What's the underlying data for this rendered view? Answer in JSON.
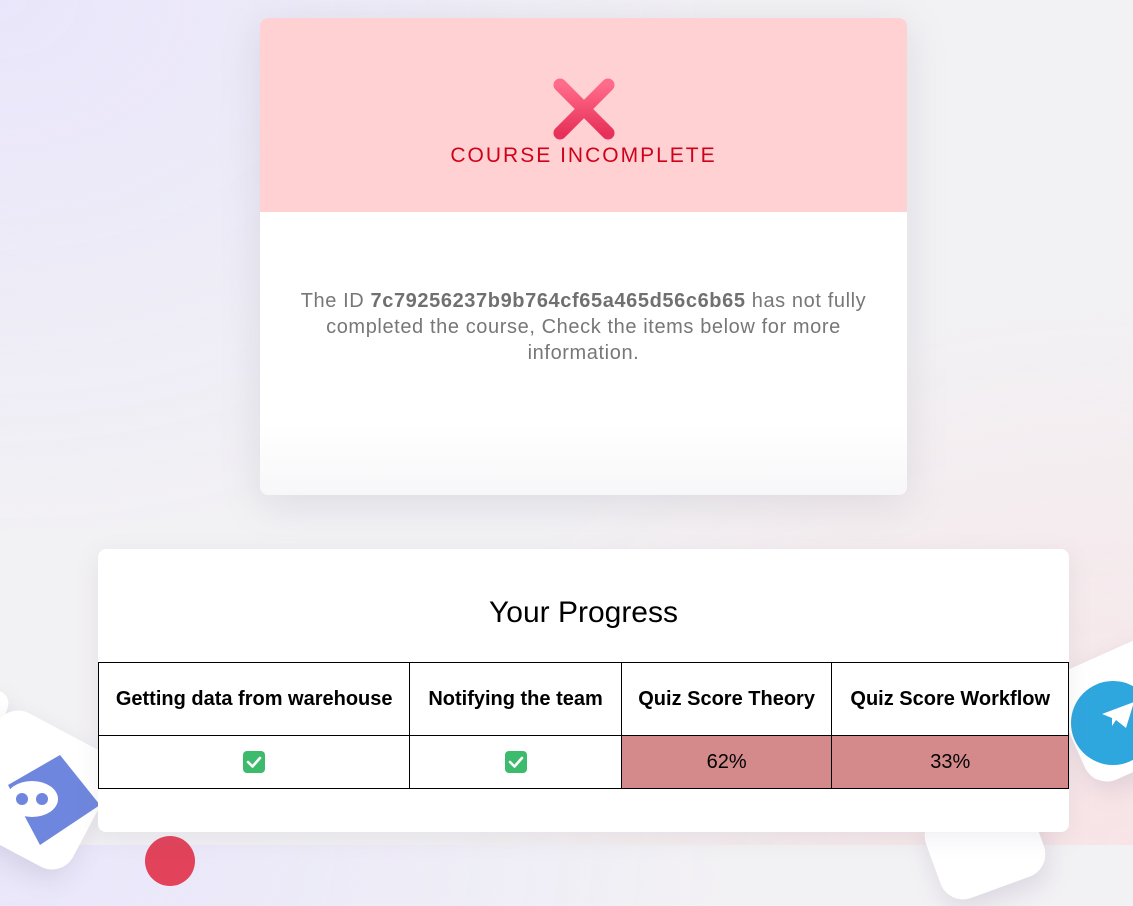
{
  "status": {
    "title": "COURSE INCOMPLETE",
    "icon": "x-icon",
    "message_prefix": "The ID ",
    "user_id": "7c79256237b9b764cf65a465d56c6b65",
    "message_suffix": " has not fully completed the course, Check the items below for more information.",
    "accent_color": "#d0021b",
    "header_color": "#ffd1d2"
  },
  "progress": {
    "title": "Your Progress",
    "columns": [
      "Getting data from warehouse",
      "Notifying the team",
      "Quiz Score Theory",
      "Quiz Score Workflow"
    ],
    "row": {
      "warehouse": "complete",
      "notify": "complete",
      "quiz_theory": "62%",
      "quiz_workflow": "33%"
    },
    "fail_color": "#d48a8a",
    "check_icon": "check-box-icon"
  }
}
